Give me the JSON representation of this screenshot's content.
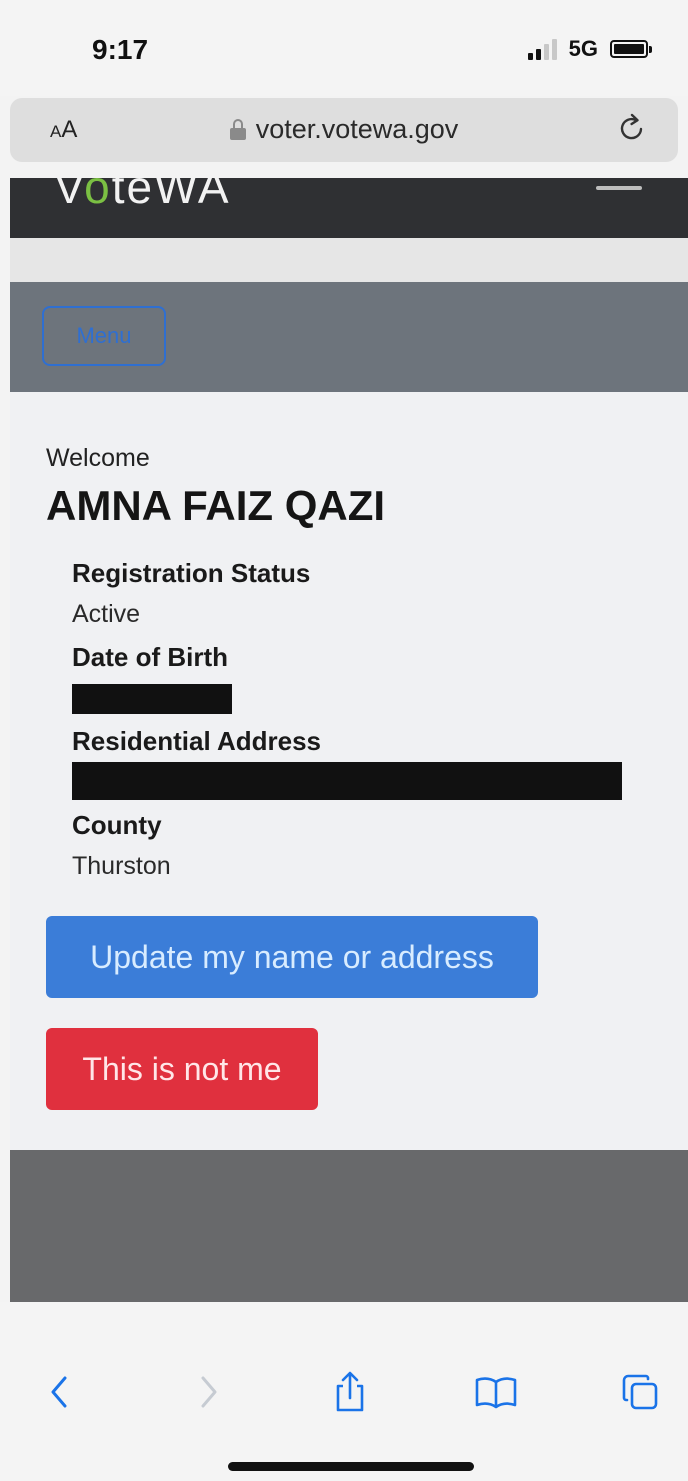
{
  "status_bar": {
    "time": "9:17",
    "network": "5G"
  },
  "browser": {
    "text_size_label": "AA",
    "url": "voter.votewa.gov",
    "icons": {
      "lock": "lock-icon",
      "reload": "reload-icon"
    }
  },
  "site": {
    "logo_text": "VoteWA",
    "menu_label": "Menu"
  },
  "voter": {
    "welcome": "Welcome",
    "name": "AMNA FAIZ QAZI",
    "fields": [
      {
        "label": "Registration Status",
        "value": "Active"
      },
      {
        "label": "Date of Birth",
        "value": null
      },
      {
        "label": "Residential Address",
        "value": null
      },
      {
        "label": "County",
        "value": "Thurston"
      }
    ]
  },
  "actions": {
    "update": "Update my name or address",
    "not_me": "This is not me"
  },
  "toolbar": {
    "icons": [
      "back-icon",
      "forward-icon",
      "share-icon",
      "bookmarks-icon",
      "tabs-icon"
    ]
  },
  "colors": {
    "primary": "#3b7dd8",
    "danger": "#e0303e",
    "header": "#2f3033",
    "menu_bar": "#6d747c",
    "ios_blue": "#1a73e8"
  }
}
